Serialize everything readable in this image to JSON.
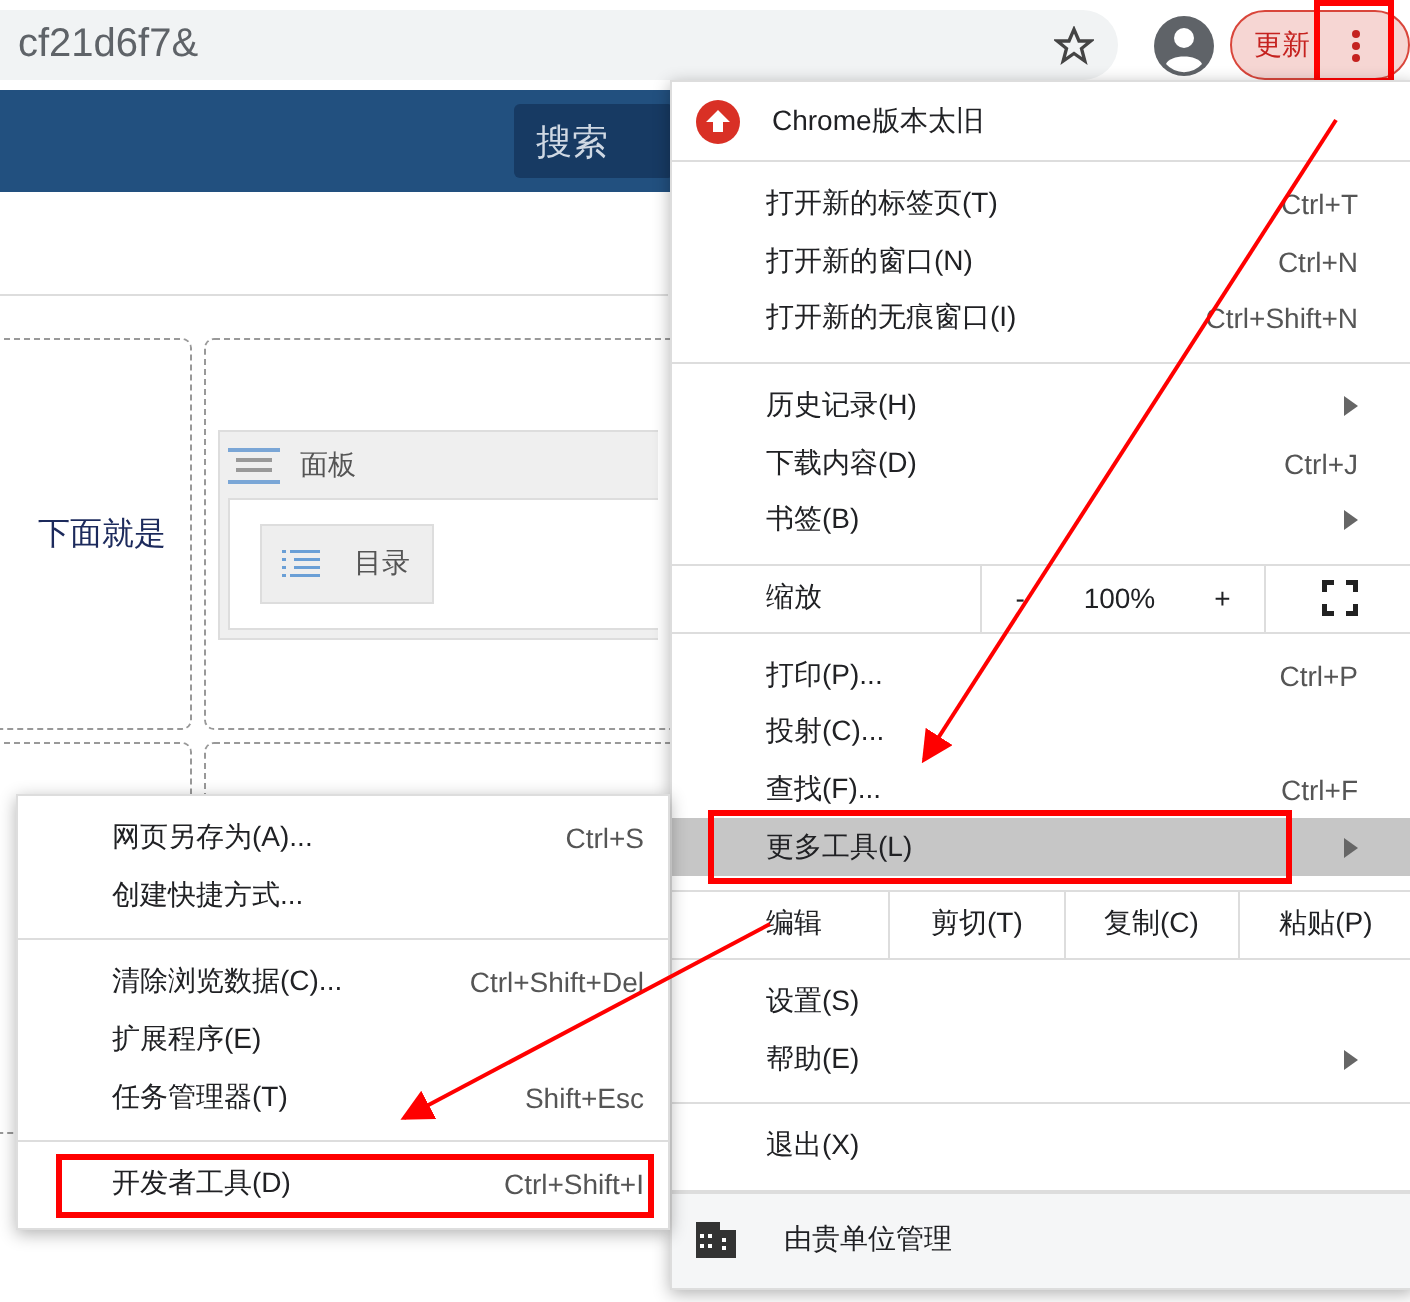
{
  "address_bar": {
    "url": "cf21d6f7&"
  },
  "update_button": {
    "label": "更新",
    "annotated": true
  },
  "nav": {
    "search_button": "搜索"
  },
  "page": {
    "card_text": "下面就是",
    "panel": {
      "title": "面板",
      "directory_button": "目录"
    }
  },
  "chrome_menu": {
    "notice": "Chrome版本太旧",
    "groups": [
      [
        {
          "kind": "command",
          "label": "打开新的标签页(T)",
          "shortcut": "Ctrl+T",
          "has_submenu": false,
          "selected": false,
          "annotated": false
        },
        {
          "kind": "command",
          "label": "打开新的窗口(N)",
          "shortcut": "Ctrl+N",
          "has_submenu": false,
          "selected": false,
          "annotated": false
        },
        {
          "kind": "command",
          "label": "打开新的无痕窗口(I)",
          "shortcut": "Ctrl+Shift+N",
          "has_submenu": false,
          "selected": false,
          "annotated": false
        }
      ],
      [
        {
          "kind": "command",
          "label": "历史记录(H)",
          "has_submenu": true,
          "selected": false,
          "annotated": false
        },
        {
          "kind": "command",
          "label": "下载内容(D)",
          "shortcut": "Ctrl+J",
          "has_submenu": false,
          "selected": false,
          "annotated": false
        },
        {
          "kind": "command",
          "label": "书签(B)",
          "has_submenu": true,
          "selected": false,
          "annotated": false
        }
      ],
      [
        {
          "kind": "zoom",
          "label": "缩放",
          "decrease": "-",
          "value": "100%",
          "increase": "+"
        }
      ],
      [
        {
          "kind": "command",
          "label": "打印(P)...",
          "shortcut": "Ctrl+P",
          "has_submenu": false,
          "selected": false,
          "annotated": false
        },
        {
          "kind": "command",
          "label": "投射(C)...",
          "has_submenu": false,
          "selected": false,
          "annotated": false
        },
        {
          "kind": "command",
          "label": "查找(F)...",
          "shortcut": "Ctrl+F",
          "has_submenu": false,
          "selected": false,
          "annotated": false
        },
        {
          "kind": "command",
          "label": "更多工具(L)",
          "has_submenu": true,
          "selected": true,
          "annotated": true
        }
      ],
      [
        {
          "kind": "edit",
          "label": "编辑",
          "actions": [
            "剪切(T)",
            "复制(C)",
            "粘贴(P)"
          ]
        }
      ],
      [
        {
          "kind": "command",
          "label": "设置(S)",
          "has_submenu": false,
          "selected": false,
          "annotated": false
        },
        {
          "kind": "command",
          "label": "帮助(E)",
          "has_submenu": true,
          "selected": false,
          "annotated": false
        }
      ],
      [
        {
          "kind": "command",
          "label": "退出(X)",
          "has_submenu": false,
          "selected": false,
          "annotated": false
        }
      ]
    ],
    "footer": "由贵单位管理"
  },
  "more_tools_menu": {
    "groups": [
      [
        {
          "label": "网页另存为(A)...",
          "shortcut": "Ctrl+S",
          "annotated": false
        },
        {
          "label": "创建快捷方式...",
          "annotated": false
        }
      ],
      [
        {
          "label": "清除浏览数据(C)...",
          "shortcut": "Ctrl+Shift+Del",
          "annotated": false
        },
        {
          "label": "扩展程序(E)",
          "annotated": false
        },
        {
          "label": "任务管理器(T)",
          "shortcut": "Shift+Esc",
          "annotated": false
        }
      ],
      [
        {
          "label": "开发者工具(D)",
          "shortcut": "Ctrl+Shift+I",
          "annotated": true
        }
      ]
    ]
  }
}
